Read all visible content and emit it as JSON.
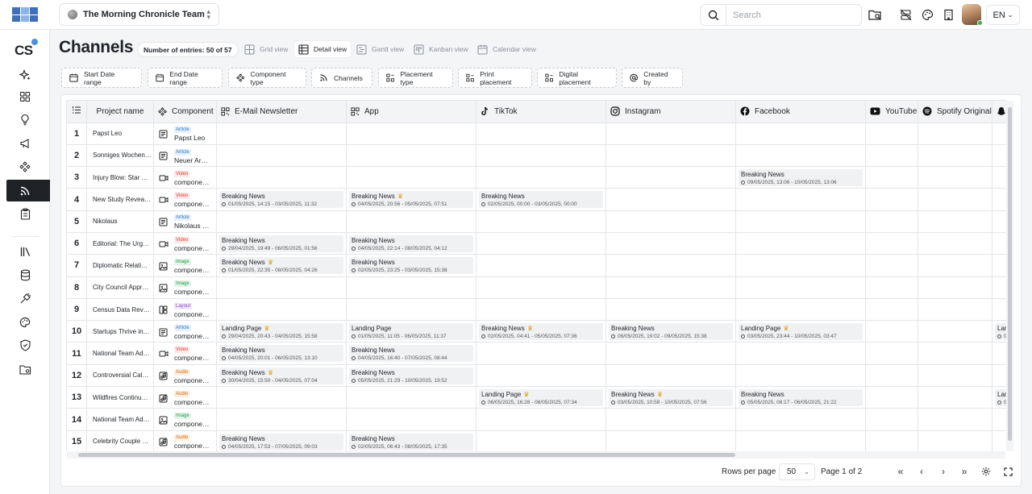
{
  "topbar": {
    "team_name": "The Morning Chronicle Team",
    "search_placeholder": "Search",
    "language": "EN"
  },
  "sidebar": {
    "brand": "CS",
    "items": [
      {
        "icon": "sparkle-icon"
      },
      {
        "icon": "dashboard-icon"
      },
      {
        "icon": "lightbulb-icon"
      },
      {
        "icon": "megaphone-icon"
      },
      {
        "icon": "components-icon"
      },
      {
        "icon": "rss-channels-icon",
        "active": true
      },
      {
        "icon": "clipboard-icon"
      },
      {
        "icon": "library-icon"
      },
      {
        "icon": "database-icon"
      },
      {
        "icon": "plug-icon"
      },
      {
        "icon": "palette-icon"
      },
      {
        "icon": "shield-icon"
      },
      {
        "icon": "folder-settings-icon"
      }
    ]
  },
  "page": {
    "title": "Channels",
    "entries": "Number of entries: 50 of 57"
  },
  "views": [
    {
      "label": "Grid view",
      "icon": "grid-icon"
    },
    {
      "label": "Detail view",
      "icon": "table-icon",
      "active": true
    },
    {
      "label": "Gantt view",
      "icon": "gantt-icon"
    },
    {
      "label": "Kanban view",
      "icon": "kanban-icon"
    },
    {
      "label": "Calendar view",
      "icon": "calendar-icon"
    }
  ],
  "filters": [
    {
      "label": "Start Date range",
      "icon": "calendar-icon"
    },
    {
      "label": "End Date range",
      "icon": "calendar-icon"
    },
    {
      "label": "Component type",
      "icon": "components-icon"
    },
    {
      "label": "Channels",
      "icon": "rss-icon"
    },
    {
      "label": "Placement type",
      "icon": "placement-icon"
    },
    {
      "label": "Print placement",
      "icon": "placement-icon"
    },
    {
      "label": "Digital placement",
      "icon": "placement-icon"
    },
    {
      "label": "Created by",
      "icon": "at-icon"
    }
  ],
  "table": {
    "columns": {
      "project": "Project name",
      "component": "Component",
      "email": "E-Mail Newsletter",
      "app": "App",
      "tiktok": "TikTok",
      "instagram": "Instagram",
      "facebook": "Facebook",
      "youtube": "YouTube",
      "spotify": "Spotify Original"
    },
    "rows": [
      {
        "num": "1",
        "project": "Papst Leo",
        "type": "Article",
        "component": "Papst Leo",
        "cells": {}
      },
      {
        "num": "2",
        "project": "Sonniges Wochen…",
        "type": "Article",
        "component": "Neuer Ar…",
        "cells": {}
      },
      {
        "num": "3",
        "project": "Injury Blow: Star …",
        "type": "Video",
        "component": "compone…",
        "cells": {
          "facebook": {
            "title": "Breaking News",
            "date": "09/05/2025, 13:06 - 10/05/2025, 13:06"
          }
        }
      },
      {
        "num": "4",
        "project": "New Study Revea…",
        "type": "Video",
        "component": "compone…",
        "cells": {
          "email": {
            "title": "Breaking News",
            "date": "01/05/2025, 14:15 - 03/05/2025, 11:32"
          },
          "app": {
            "title": "Breaking News",
            "trophy": true,
            "date": "04/05/2025, 20:56 - 05/05/2025, 07:51"
          },
          "tiktok": {
            "title": "Breaking News",
            "date": "02/05/2025, 00:00 - 03/05/2025, 00:00"
          }
        }
      },
      {
        "num": "5",
        "project": "Nikolaus",
        "type": "Article",
        "component": "Nikolaus …",
        "cells": {}
      },
      {
        "num": "6",
        "project": "Editorial: The Urg…",
        "type": "Video",
        "component": "compone…",
        "cells": {
          "email": {
            "title": "Breaking News",
            "date": "29/04/2025, 19:49 - 06/05/2025, 01:56"
          },
          "app": {
            "title": "Breaking News",
            "date": "04/05/2025, 22:14 - 08/05/2025, 04:12"
          }
        }
      },
      {
        "num": "7",
        "project": "Diplomatic Relati…",
        "type": "Image",
        "component": "compone…",
        "cells": {
          "email": {
            "title": "Breaking News",
            "trophy": true,
            "date": "01/05/2025, 22:35 - 08/05/2025, 04:26"
          },
          "app": {
            "title": "Breaking News",
            "date": "02/05/2025, 23:25 - 03/05/2025, 15:38"
          }
        }
      },
      {
        "num": "8",
        "project": "City Council Appr…",
        "type": "Image",
        "component": "compone…",
        "cells": {}
      },
      {
        "num": "9",
        "project": "Census Data Rev…",
        "type": "Layout",
        "component": "compone…",
        "cells": {}
      },
      {
        "num": "10",
        "project": "Startups Thrive in…",
        "type": "Article",
        "component": "compone…",
        "cells": {
          "email": {
            "title": "Landing Page",
            "trophy": true,
            "date": "29/04/2025, 20:43 - 04/05/2025, 15:58"
          },
          "app": {
            "title": "Landing Page",
            "date": "01/05/2025, 11:05 - 06/05/2025, 11:37"
          },
          "tiktok": {
            "title": "Breaking News",
            "trophy": true,
            "date": "02/05/2025, 04:41 - 05/05/2025, 07:36"
          },
          "instagram": {
            "title": "Breaking News",
            "date": "06/05/2025, 19:02 - 09/05/2025, 15:38"
          },
          "facebook": {
            "title": "Landing Page",
            "trophy": true,
            "date": "03/05/2025, 23:44 - 10/05/2025, 03:47"
          },
          "extra": {
            "title": "Lan",
            "date": "0"
          }
        }
      },
      {
        "num": "11",
        "project": "National Team Ad…",
        "type": "Video",
        "component": "compone…",
        "cells": {
          "email": {
            "title": "Breaking News",
            "date": "04/05/2025, 20:01 - 06/05/2025, 13:10"
          },
          "app": {
            "title": "Breaking News",
            "date": "04/05/2025, 16:40 - 07/05/2025, 08:44"
          }
        }
      },
      {
        "num": "12",
        "project": "Controversial Cal…",
        "type": "Audio",
        "component": "compone…",
        "cells": {
          "email": {
            "title": "Breaking News",
            "trophy": true,
            "date": "30/04/2025, 15:50 - 04/05/2025, 07:04"
          },
          "app": {
            "title": "Breaking News",
            "date": "05/05/2025, 21:29 - 10/05/2025, 19:52"
          }
        }
      },
      {
        "num": "13",
        "project": "Wildfires Continu…",
        "type": "Audio",
        "component": "compone…",
        "cells": {
          "tiktok": {
            "title": "Landing Page",
            "trophy": true,
            "date": "06/05/2025, 16:28 - 08/05/2025, 07:34"
          },
          "instagram": {
            "title": "Breaking News",
            "trophy": true,
            "date": "03/05/2025, 10:58 - 10/05/2025, 07:56"
          },
          "facebook": {
            "title": "Breaking News",
            "date": "05/05/2025, 08:17 - 06/05/2025, 21:22"
          },
          "extra": {
            "title": "Lan",
            "date": "0"
          }
        }
      },
      {
        "num": "14",
        "project": "National Team Ad…",
        "type": "Image",
        "component": "compone…",
        "cells": {}
      },
      {
        "num": "15",
        "project": "Celebrity Couple …",
        "type": "Audio",
        "component": "compone…",
        "cells": {
          "email": {
            "title": "Breaking News",
            "date": "04/05/2025, 17:53 - 07/05/2025, 09:03"
          },
          "app": {
            "title": "Breaking News",
            "date": "02/05/2025, 06:43 - 08/05/2025, 17:35"
          }
        }
      }
    ]
  },
  "pagination": {
    "rows_per_page_label": "Rows per page",
    "rows_per_page": "50",
    "page_info": "Page 1 of 2"
  }
}
